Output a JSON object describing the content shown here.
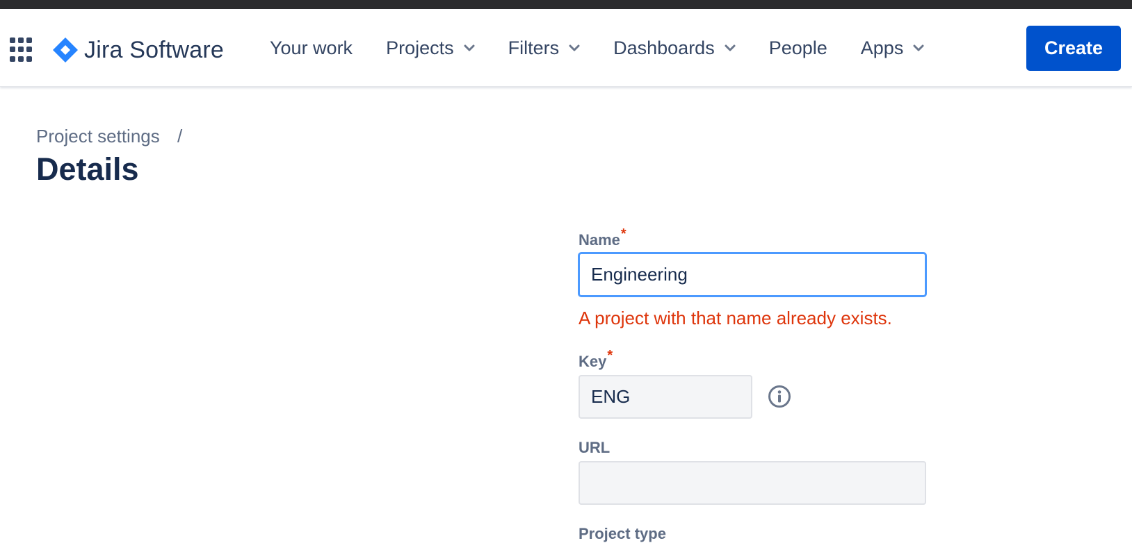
{
  "app": {
    "logo_text": "Jira Software",
    "brand_color": "#2684ff"
  },
  "nav": {
    "items": [
      {
        "label": "Your work",
        "dropdown": false
      },
      {
        "label": "Projects",
        "dropdown": true
      },
      {
        "label": "Filters",
        "dropdown": true
      },
      {
        "label": "Dashboards",
        "dropdown": true
      },
      {
        "label": "People",
        "dropdown": false
      },
      {
        "label": "Apps",
        "dropdown": true
      }
    ],
    "create_label": "Create",
    "create_color": "#0052cc"
  },
  "breadcrumb": {
    "parent": "Project settings",
    "separator": "/"
  },
  "page": {
    "title": "Details"
  },
  "form": {
    "name": {
      "label": "Name",
      "required_mark": "*",
      "value": "Engineering",
      "error": "A project with that name already exists."
    },
    "key": {
      "label": "Key",
      "required_mark": "*",
      "value": "ENG",
      "info_icon": "info-icon"
    },
    "url": {
      "label": "URL",
      "value": ""
    },
    "project_type": {
      "label": "Project type"
    }
  },
  "colors": {
    "error": "#de350b",
    "focus": "#4c9aff",
    "text": "#172b4d"
  }
}
